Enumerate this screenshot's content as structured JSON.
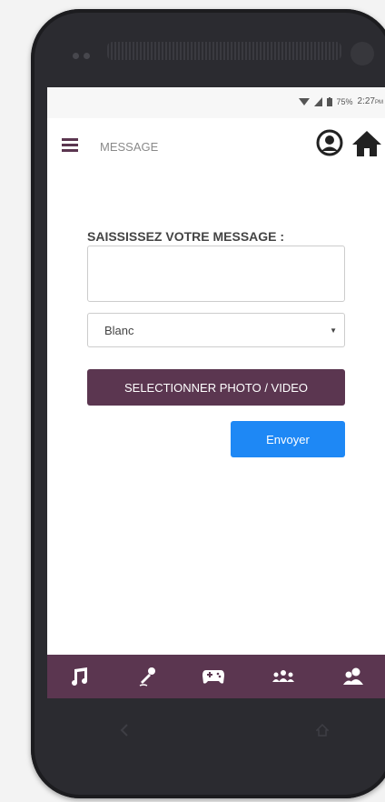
{
  "status_bar": {
    "battery": "75%",
    "time": "2:27",
    "time_suffix": "PM"
  },
  "app_bar": {
    "title": "MESSAGE",
    "menu_icon": "hamburger-menu-icon",
    "profile_icon": "user-circle-icon",
    "home_icon": "home-icon"
  },
  "form": {
    "label": "SAISSISSEZ VOTRE MESSAGE :",
    "message_value": "",
    "color_select": {
      "selected": "Blanc"
    },
    "photo_button": "SELECTIONNER PHOTO / VIDEO",
    "send_button": "Envoyer"
  },
  "bottom_nav": [
    {
      "icon": "music-note-icon"
    },
    {
      "icon": "microphone-icon"
    },
    {
      "icon": "gamepad-icon"
    },
    {
      "icon": "group-icon"
    },
    {
      "icon": "friends-icon"
    }
  ],
  "colors": {
    "primary": "#5b3650",
    "accent": "#1e88f5",
    "phone_body": "#2b2b30"
  }
}
